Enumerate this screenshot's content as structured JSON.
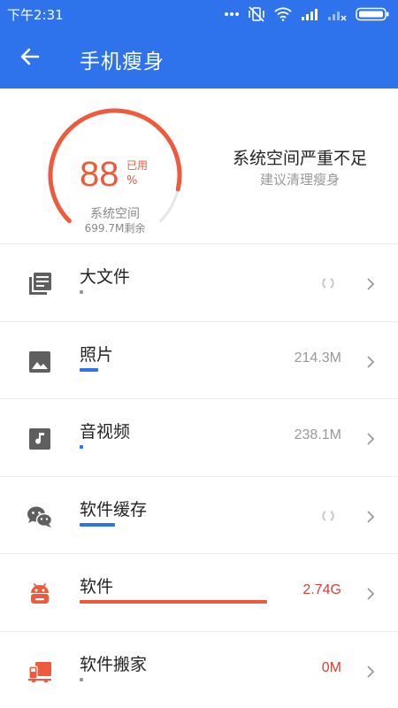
{
  "status_bar": {
    "time": "下午2:31",
    "icons": [
      "more-dots-icon",
      "vibrate-off-icon",
      "wifi-icon",
      "signal-icon",
      "signal-x-icon",
      "battery-icon"
    ]
  },
  "toolbar": {
    "title": "手机瘦身",
    "back_icon": "arrow-left-icon"
  },
  "summary": {
    "percent": "88",
    "percent_value": 88,
    "used_label": "已用",
    "unit": "%",
    "storage_label": "系统空间",
    "remaining": "699.7M剩余",
    "warning_title": "系统空间严重不足",
    "warning_subtitle": "建议清理瘦身",
    "gauge_color": "#ef5a3c",
    "gauge_track_color": "#e6e6e6"
  },
  "items": [
    {
      "label": "大文件",
      "value": "",
      "loading": true,
      "bar_fraction": 0.02,
      "bar_color": "#999999",
      "icon": "document-stack-icon",
      "value_color": "gray"
    },
    {
      "label": "照片",
      "value": "214.3M",
      "loading": false,
      "bar_fraction": 0.1,
      "bar_color": "#2f73ec",
      "icon": "image-icon",
      "value_color": "gray"
    },
    {
      "label": "音视频",
      "value": "238.1M",
      "loading": false,
      "bar_fraction": 0.02,
      "bar_color": "#2f73ec",
      "icon": "music-note-icon",
      "value_color": "gray"
    },
    {
      "label": "软件缓存",
      "value": "",
      "loading": true,
      "bar_fraction": 0.19,
      "bar_color": "#2f73ec",
      "icon": "wechat-icon",
      "value_color": "gray"
    },
    {
      "label": "软件",
      "value": "2.74G",
      "loading": false,
      "bar_fraction": 1.0,
      "bar_color": "#ef5a3c",
      "icon": "android-icon",
      "value_color": "red"
    },
    {
      "label": "软件搬家",
      "value": "0M",
      "loading": false,
      "bar_fraction": 0.02,
      "bar_color": "#999999",
      "icon": "moving-truck-icon",
      "value_color": "red"
    }
  ],
  "colors": {
    "app_bar": "#2f73ec",
    "accent_red": "#ef5a3c",
    "icon_gray": "#5f5f5f"
  }
}
